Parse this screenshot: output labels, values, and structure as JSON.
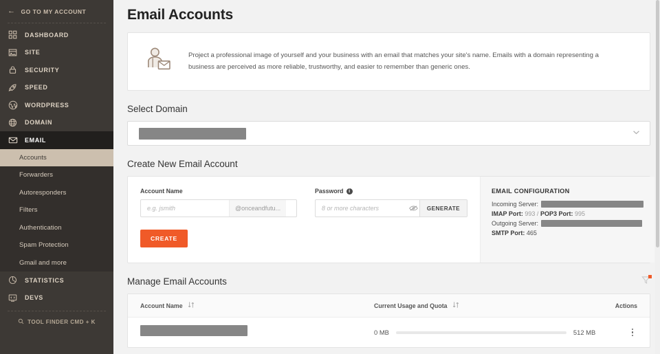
{
  "sidebar": {
    "back_label": "GO TO MY ACCOUNT",
    "items": [
      {
        "label": "DASHBOARD",
        "icon": "grid-icon"
      },
      {
        "label": "SITE",
        "icon": "site-icon"
      },
      {
        "label": "SECURITY",
        "icon": "lock-icon"
      },
      {
        "label": "SPEED",
        "icon": "rocket-icon"
      },
      {
        "label": "WORDPRESS",
        "icon": "wordpress-icon"
      },
      {
        "label": "DOMAIN",
        "icon": "globe-icon"
      },
      {
        "label": "EMAIL",
        "icon": "envelope-icon"
      }
    ],
    "email_subitems": [
      "Accounts",
      "Forwarders",
      "Autoresponders",
      "Filters",
      "Authentication",
      "Spam Protection",
      "Gmail and more"
    ],
    "active_subitem": "Accounts",
    "items_bottom": [
      {
        "label": "STATISTICS",
        "icon": "pie-chart-icon"
      },
      {
        "label": "DEVS",
        "icon": "code-monitor-icon"
      }
    ],
    "tool_finder": "TOOL FINDER CMD + K"
  },
  "header": {
    "title": "Email Accounts"
  },
  "banner": {
    "icon": "person-email-icon",
    "text": "Project a professional image of yourself and your business with an email that matches your site's name. Emails with a domain representing a business are perceived as more reliable, trustworthy, and easier to remember than generic ones."
  },
  "select_domain": {
    "title": "Select Domain",
    "value": "",
    "redacted": true,
    "chevron": "chevron-down-icon"
  },
  "create_account": {
    "title": "Create New Email Account",
    "account_name_label": "Account Name",
    "account_name_placeholder": "e.g. jsmith",
    "account_name_value": "",
    "domain_suffix": "@onceandfutu...",
    "password_label": "Password",
    "password_info": "i",
    "password_placeholder": "8 or more characters",
    "password_value": "",
    "show_password_icon": "eye-icon",
    "generate_label": "GENERATE",
    "create_label": "CREATE",
    "create_button_color": "#f05a28"
  },
  "email_configuration": {
    "title": "EMAIL CONFIGURATION",
    "incoming_server_label": "Incoming Server:",
    "incoming_server_value": "",
    "incoming_server_redacted": true,
    "imap_port_label": "IMAP Port:",
    "imap_port_value": "993",
    "separator": "/",
    "pop3_port_label": "POP3 Port:",
    "pop3_port_value": "995",
    "outgoing_server_label": "Outgoing Server:",
    "outgoing_server_value": "",
    "outgoing_server_redacted": true,
    "smtp_port_label": "SMTP Port:",
    "smtp_port_value": "465"
  },
  "manage_accounts": {
    "title": "Manage Email Accounts",
    "filter_icon": "filter-icon",
    "filter_badge_color": "#f05a28",
    "columns": [
      {
        "label": "Account Name",
        "sortable": true
      },
      {
        "label": "Current Usage and Quota",
        "sortable": true
      },
      {
        "label": "Actions",
        "sortable": false
      }
    ],
    "rows": [
      {
        "account_name": "",
        "account_name_redacted": true,
        "usage": "0 MB",
        "quota": "512 MB",
        "usage_percent": 0,
        "actions_icon": "kebab-menu-icon"
      }
    ]
  }
}
